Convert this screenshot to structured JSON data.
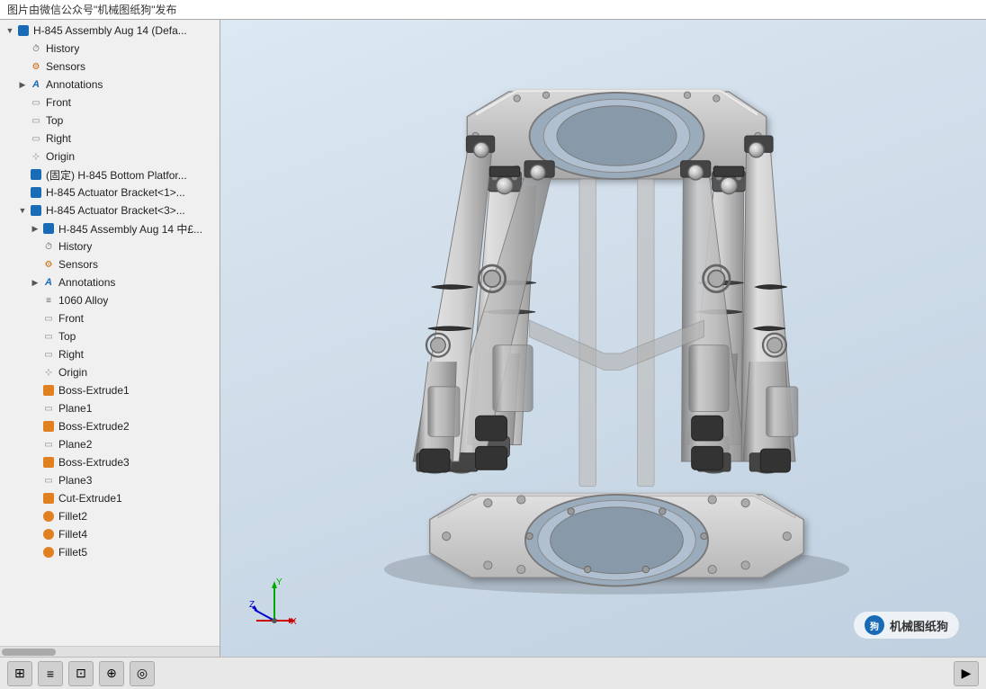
{
  "watermark": {
    "text": "图片由微信公众号\"机械图纸狗\"发布"
  },
  "sidebar": {
    "items": [
      {
        "id": "root",
        "label": "H-845 Assembly Aug 14  (Defa...",
        "level": 0,
        "icon": "assembly",
        "expandable": true,
        "expanded": true
      },
      {
        "id": "history1",
        "label": "History",
        "level": 1,
        "icon": "history",
        "expandable": false
      },
      {
        "id": "sensors1",
        "label": "Sensors",
        "level": 1,
        "icon": "sensor",
        "expandable": false
      },
      {
        "id": "annotations1",
        "label": "Annotations",
        "level": 1,
        "icon": "annotation",
        "expandable": false
      },
      {
        "id": "front1",
        "label": "Front",
        "level": 1,
        "icon": "plane",
        "expandable": false
      },
      {
        "id": "top1",
        "label": "Top",
        "level": 1,
        "icon": "plane",
        "expandable": false
      },
      {
        "id": "right1",
        "label": "Right",
        "level": 1,
        "icon": "plane",
        "expandable": false
      },
      {
        "id": "origin1",
        "label": "Origin",
        "level": 1,
        "icon": "origin",
        "expandable": false
      },
      {
        "id": "bottom-platform",
        "label": "(固定) H-845 Bottom Platfor...",
        "level": 1,
        "icon": "part",
        "expandable": false
      },
      {
        "id": "actuator-bracket1",
        "label": "H-845 Actuator Bracket<1>...",
        "level": 1,
        "icon": "part",
        "expandable": false
      },
      {
        "id": "actuator-bracket3",
        "label": "H-845 Actuator Bracket<3>...",
        "level": 1,
        "icon": "part",
        "expandable": true,
        "expanded": true
      },
      {
        "id": "assembly-sub",
        "label": "H-845 Assembly Aug 14 中£...",
        "level": 2,
        "icon": "assembly",
        "expandable": false
      },
      {
        "id": "history2",
        "label": "History",
        "level": 2,
        "icon": "history",
        "expandable": false
      },
      {
        "id": "sensors2",
        "label": "Sensors",
        "level": 2,
        "icon": "sensor",
        "expandable": false
      },
      {
        "id": "annotations2",
        "label": "Annotations",
        "level": 2,
        "icon": "annotation",
        "expandable": false
      },
      {
        "id": "alloy1060",
        "label": "1060 Alloy",
        "level": 2,
        "icon": "material",
        "expandable": false
      },
      {
        "id": "front2",
        "label": "Front",
        "level": 2,
        "icon": "plane",
        "expandable": false
      },
      {
        "id": "top2",
        "label": "Top",
        "level": 2,
        "icon": "plane",
        "expandable": false
      },
      {
        "id": "right2",
        "label": "Right",
        "level": 2,
        "icon": "plane",
        "expandable": false
      },
      {
        "id": "origin2",
        "label": "Origin",
        "level": 2,
        "icon": "origin",
        "expandable": false
      },
      {
        "id": "boss-extrude1",
        "label": "Boss-Extrude1",
        "level": 2,
        "icon": "feature",
        "expandable": false
      },
      {
        "id": "plane1",
        "label": "Plane1",
        "level": 2,
        "icon": "plane",
        "expandable": false
      },
      {
        "id": "boss-extrude2",
        "label": "Boss-Extrude2",
        "level": 2,
        "icon": "feature",
        "expandable": false
      },
      {
        "id": "plane2",
        "label": "Plane2",
        "level": 2,
        "icon": "plane",
        "expandable": false
      },
      {
        "id": "boss-extrude3",
        "label": "Boss-Extrude3",
        "level": 2,
        "icon": "feature",
        "expandable": false
      },
      {
        "id": "plane3",
        "label": "Plane3",
        "level": 2,
        "icon": "plane",
        "expandable": false
      },
      {
        "id": "cut-extrude1",
        "label": "Cut-Extrude1",
        "level": 2,
        "icon": "feature",
        "expandable": false
      },
      {
        "id": "fillet2",
        "label": "Fillet2",
        "level": 2,
        "icon": "fillet",
        "expandable": false
      },
      {
        "id": "fillet4",
        "label": "Fillet4",
        "level": 2,
        "icon": "fillet",
        "expandable": false
      },
      {
        "id": "fillet5",
        "label": "Fillet5",
        "level": 2,
        "icon": "fillet",
        "expandable": false
      }
    ]
  },
  "toolbar": {
    "buttons": [
      "⊞",
      "≡",
      "⊡",
      "⊕",
      "◎",
      "▶"
    ]
  },
  "logo": {
    "circle_text": "狗",
    "text": "机械图纸狗"
  },
  "axis": {
    "x_label": "X",
    "y_label": "Y",
    "z_label": "Z"
  }
}
